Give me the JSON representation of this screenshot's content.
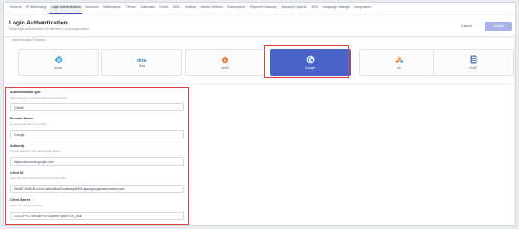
{
  "tabs": [
    {
      "label": "General"
    },
    {
      "label": "IP Whitelisting"
    },
    {
      "label": "Login Authentication",
      "active": true
    },
    {
      "label": "Sessions"
    },
    {
      "label": "Notifications"
    },
    {
      "label": "Theme"
    },
    {
      "label": "Calendars"
    },
    {
      "label": "Email"
    },
    {
      "label": "SMS"
    },
    {
      "label": "Chatbot"
    },
    {
      "label": "Mobile Devices"
    },
    {
      "label": "Subscription"
    },
    {
      "label": "Payment Gateway"
    },
    {
      "label": "Branding Options"
    },
    {
      "label": "MFA"
    },
    {
      "label": "Language Settings"
    },
    {
      "label": "Integrations"
    }
  ],
  "header": {
    "title": "Login Authentication",
    "subtitle": "Setup login authentication for all users in your organization",
    "cancel_label": "Cancel",
    "update_label": "Update"
  },
  "providers": {
    "section_label": "Authentication Providers",
    "items": [
      {
        "name": "Azure",
        "icon": "azure-icon",
        "color": "#3aa6d8"
      },
      {
        "name": "Okta",
        "icon": "okta-icon",
        "color": "#2f86c8"
      },
      {
        "name": "Auth0",
        "icon": "auth0-icon",
        "color": "#e8703a"
      },
      {
        "name": "Google",
        "icon": "google-icon",
        "selected": true
      },
      {
        "name": "AD",
        "icon": "ad-icon",
        "color": "#f3a43b"
      },
      {
        "name": "LDAP",
        "icon": "ldap-icon",
        "color": "#5a7fb5"
      }
    ]
  },
  "form": {
    "auth_type": {
      "label": "Authentication type",
      "help": "Select the type of authentication from below list",
      "value": "OAuth"
    },
    "provider_name": {
      "label": "Provider Name",
      "help": "A name to identify the provider",
      "value": "Google"
    },
    "authority": {
      "label": "Authority",
      "help": "Provide authority URL starting with https://",
      "value": "https://accounts.google.com"
    },
    "client_id": {
      "label": "Client ID",
      "help": "Enter the Client ID number to identify the client",
      "value": "394871906026-k14m1afnc38nc67oadbd6pft0f3u.apps.googleusercontent.com"
    },
    "client_secret": {
      "label": "Client Secret",
      "help": "Enter your client secret key",
      "value": "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"
    }
  },
  "colors": {
    "accent": "#4a63c8",
    "highlight": "#e0413f",
    "update_button": "#a9b2e6"
  }
}
